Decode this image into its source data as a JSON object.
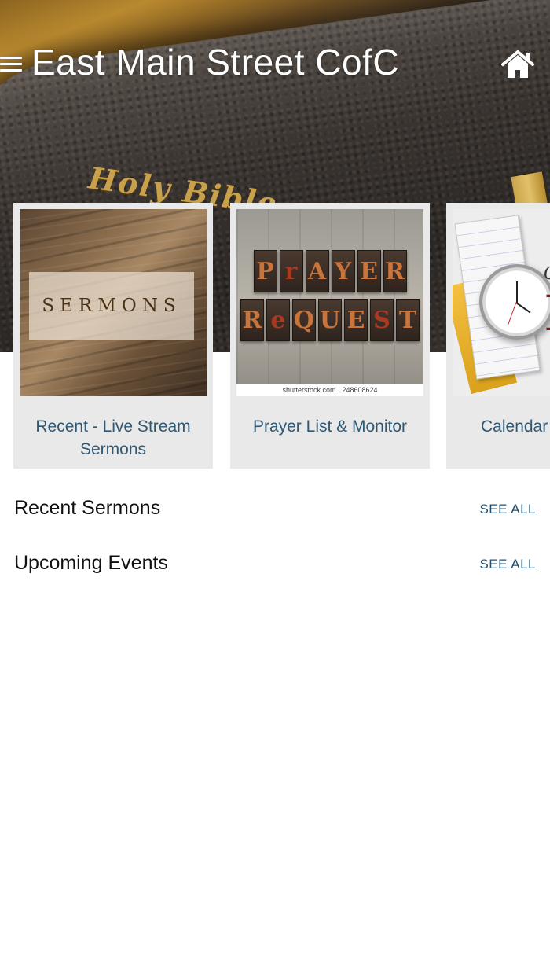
{
  "header": {
    "title": "East Main Street CofC",
    "menu_icon": "hamburger-menu-icon",
    "home_icon": "home-icon"
  },
  "hero": {
    "spine_text": "Holy Bible"
  },
  "cards": [
    {
      "label": "Recent - Live Stream Sermons",
      "image_text": "SERMONS"
    },
    {
      "label": "Prayer List & Monitor",
      "image_text_line1": "PrAYER",
      "image_text_line2": "ReQUEST",
      "image_credit": "shutterstock.com · 248608624"
    },
    {
      "label": "Calendar o",
      "image_text": "E"
    }
  ],
  "sections": {
    "recent_sermons": {
      "title": "Recent Sermons",
      "see_all": "SEE ALL"
    },
    "upcoming_events": {
      "title": "Upcoming Events",
      "see_all": "SEE ALL"
    }
  },
  "colors": {
    "accent_text": "#2f5973",
    "see_all": "#24506b",
    "card_bg": "#e9e9e9"
  }
}
